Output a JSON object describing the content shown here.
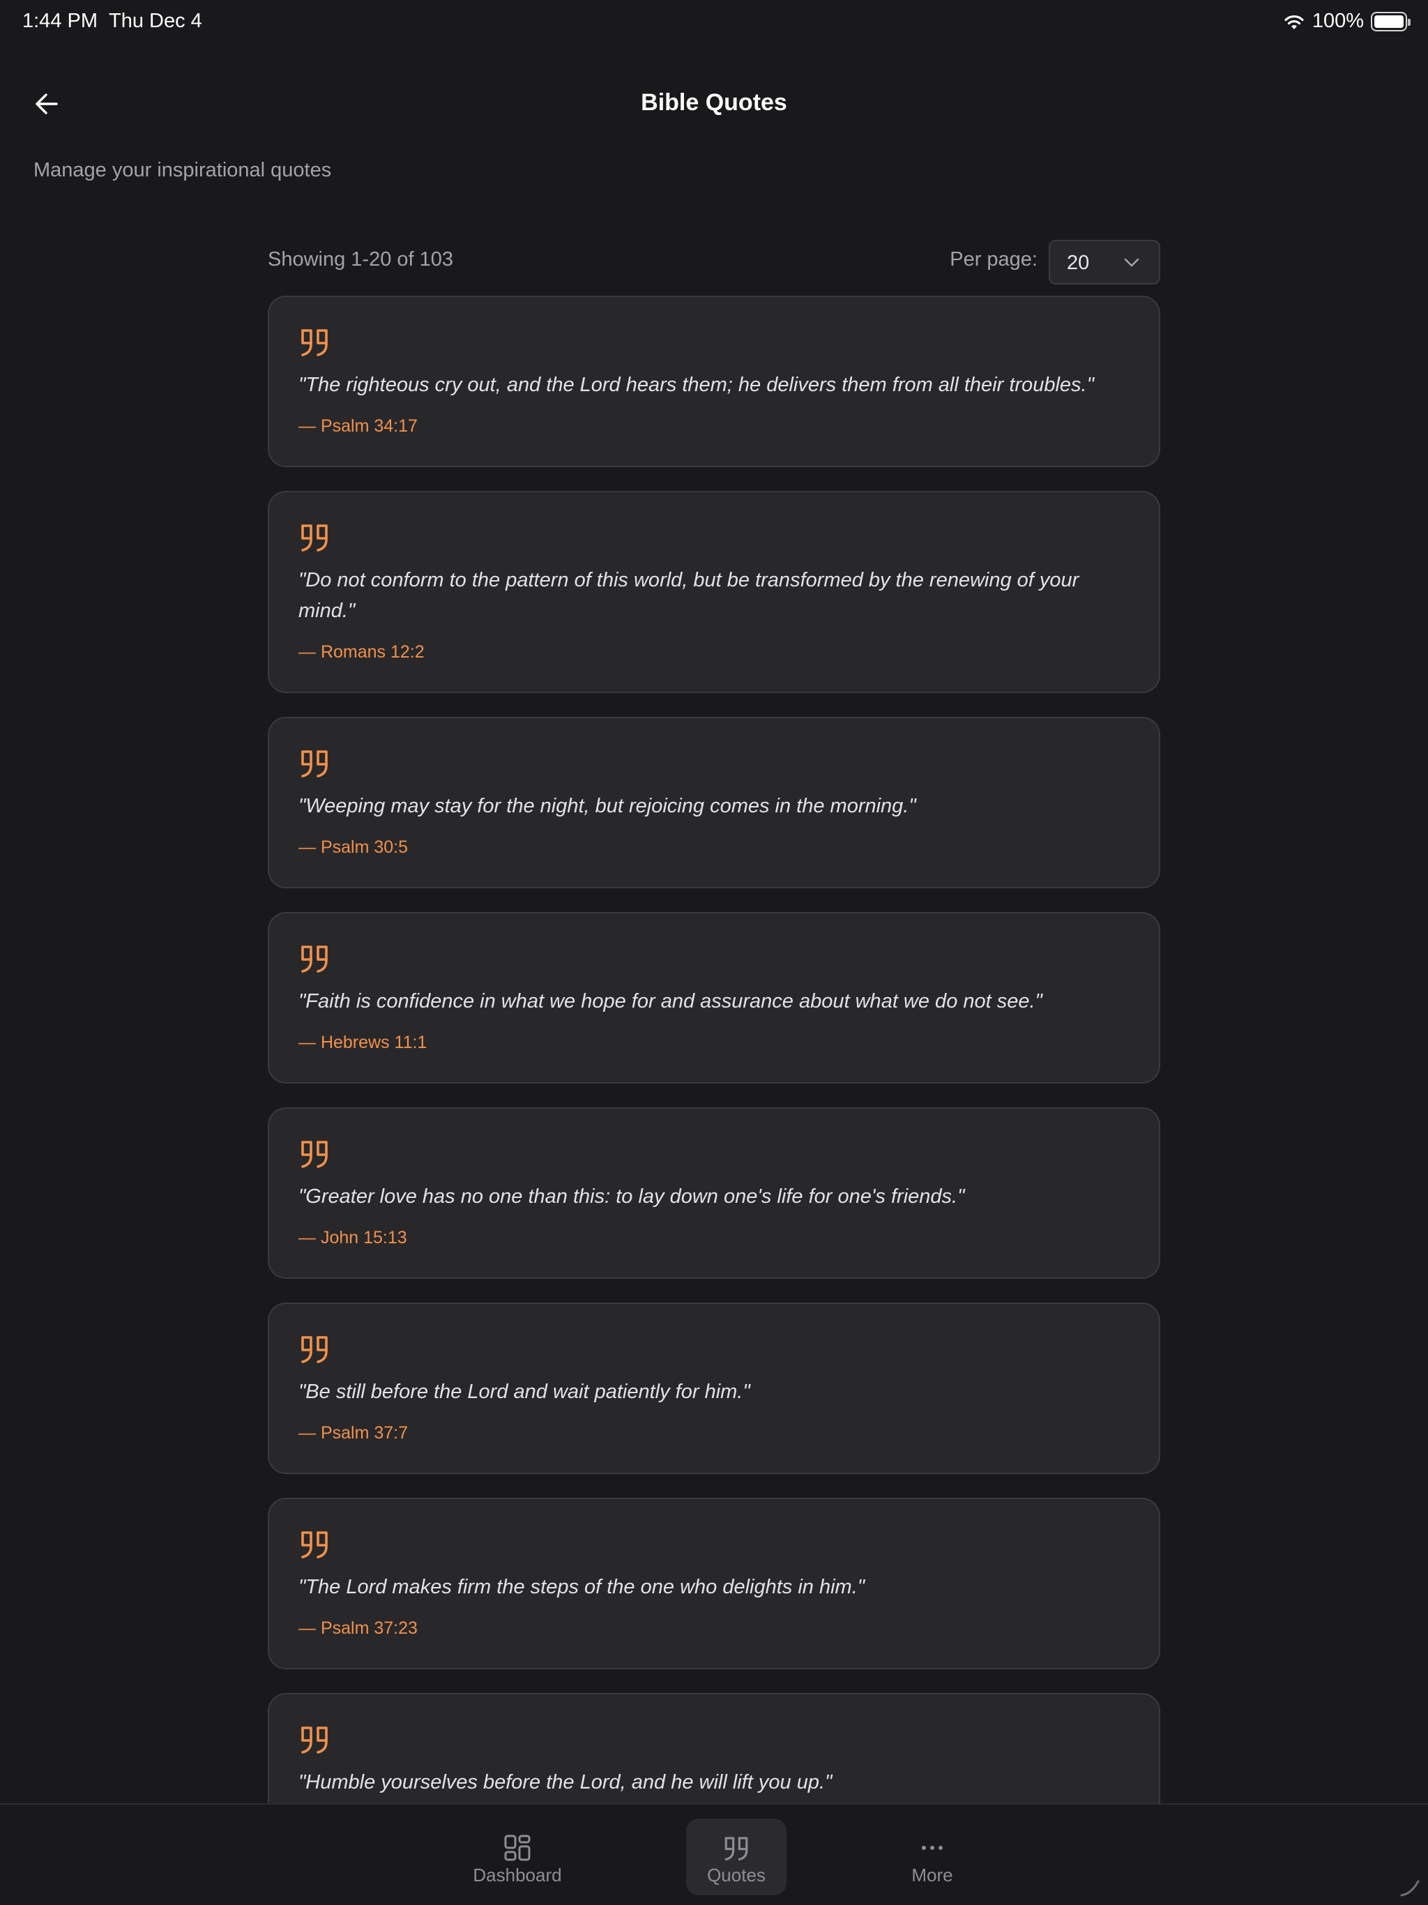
{
  "status_bar": {
    "time": "1:44 PM",
    "date": "Thu Dec 4",
    "battery": "100%"
  },
  "header": {
    "title": "Bible Quotes",
    "subtitle": "Manage your inspirational quotes"
  },
  "list_header": {
    "showing": "Showing 1-20 of 103",
    "per_page_label": "Per page:",
    "per_page_value": "20"
  },
  "quotes": [
    {
      "text": "\"The righteous cry out, and the Lord hears them; he delivers them from all their troubles.\"",
      "reference": "— Psalm 34:17"
    },
    {
      "text": "\"Do not conform to the pattern of this world, but be transformed by the renewing of your mind.\"",
      "reference": "— Romans 12:2"
    },
    {
      "text": "\"Weeping may stay for the night, but rejoicing comes in the morning.\"",
      "reference": "— Psalm 30:5"
    },
    {
      "text": "\"Faith is confidence in what we hope for and assurance about what we do not see.\"",
      "reference": "— Hebrews 11:1"
    },
    {
      "text": "\"Greater love has no one than this: to lay down one's life for one's friends.\"",
      "reference": "— John 15:13"
    },
    {
      "text": "\"Be still before the Lord and wait patiently for him.\"",
      "reference": "— Psalm 37:7"
    },
    {
      "text": "\"The Lord makes firm the steps of the one who delights in him.\"",
      "reference": "— Psalm 37:23"
    },
    {
      "text": "\"Humble yourselves before the Lord, and he will lift you up.\""
    }
  ],
  "tabs": [
    {
      "label": "Dashboard",
      "icon": "dashboard-icon",
      "active": false
    },
    {
      "label": "Quotes",
      "icon": "quote-icon",
      "active": true
    },
    {
      "label": "More",
      "icon": "more-icon",
      "active": false
    }
  ],
  "colors": {
    "background": "#19191b",
    "card": "#28282b",
    "accent": "#f2914a",
    "muted_text": "#a3a3a8"
  }
}
